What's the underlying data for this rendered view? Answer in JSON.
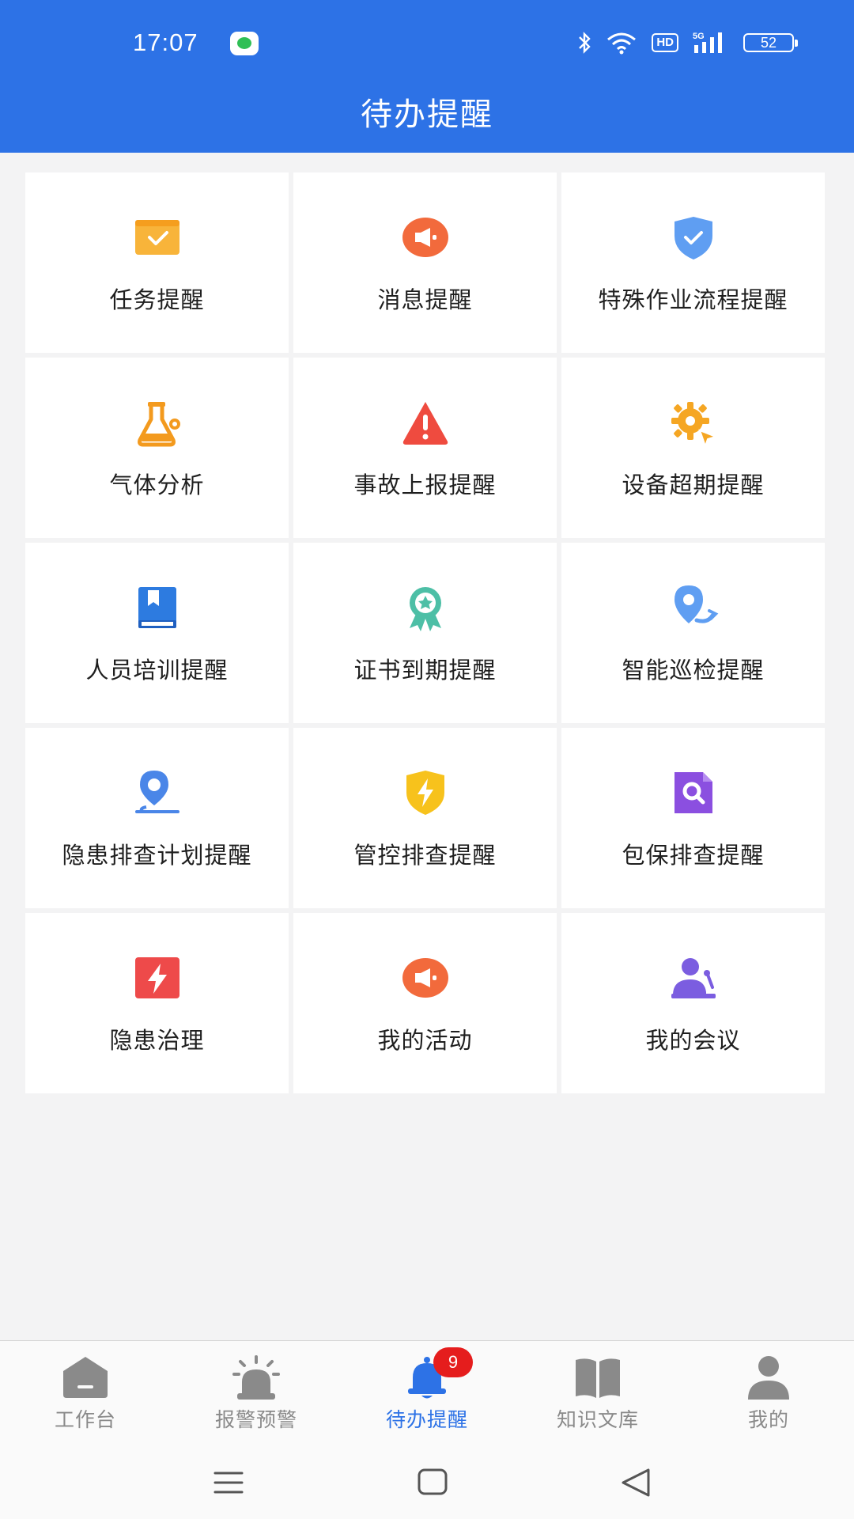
{
  "status_bar": {
    "time": "17:07",
    "network": "5G",
    "hd": "HD",
    "battery": "52"
  },
  "header": {
    "title": "待办提醒"
  },
  "grid": {
    "items": [
      {
        "label": "任务提醒",
        "icon": "task-check-icon",
        "color": "#f8b43a"
      },
      {
        "label": "消息提醒",
        "icon": "megaphone-icon",
        "color": "#f26a3c"
      },
      {
        "label": "特殊作业流程提醒",
        "icon": "shield-check-icon",
        "color": "#5f9ef2"
      },
      {
        "label": "气体分析",
        "icon": "flask-icon",
        "color": "#f39a1e"
      },
      {
        "label": "事故上报提醒",
        "icon": "warning-icon",
        "color": "#ef4b3f"
      },
      {
        "label": "设备超期提醒",
        "icon": "gear-icon",
        "color": "#f5a623"
      },
      {
        "label": "人员培训提醒",
        "icon": "book-icon",
        "color": "#2d7be0"
      },
      {
        "label": "证书到期提醒",
        "icon": "award-icon",
        "color": "#4dbfa6"
      },
      {
        "label": "智能巡检提醒",
        "icon": "patrol-location-icon",
        "color": "#5f9ef2"
      },
      {
        "label": "隐患排查计划提醒",
        "icon": "location-pin-icon",
        "color": "#4a86e8"
      },
      {
        "label": "管控排查提醒",
        "icon": "bolt-shield-icon",
        "color": "#f7c21c"
      },
      {
        "label": "包保排查提醒",
        "icon": "search-doc-icon",
        "color": "#8b4fe0"
      },
      {
        "label": "隐患治理",
        "icon": "lightning-icon",
        "color": "#ee4a4a"
      },
      {
        "label": "我的活动",
        "icon": "megaphone-icon",
        "color": "#f26a3c"
      },
      {
        "label": "我的会议",
        "icon": "meeting-icon",
        "color": "#7b5de0"
      }
    ]
  },
  "tabbar": {
    "tabs": [
      {
        "label": "工作台",
        "icon": "home-icon"
      },
      {
        "label": "报警预警",
        "icon": "alarm-icon"
      },
      {
        "label": "待办提醒",
        "icon": "bell-icon",
        "active": true,
        "badge": "9"
      },
      {
        "label": "知识文库",
        "icon": "book-open-icon"
      },
      {
        "label": "我的",
        "icon": "user-icon"
      }
    ]
  },
  "colors": {
    "brand": "#2d72e6",
    "badge": "#e51d1d",
    "tab_inactive": "#8a8a8a"
  }
}
